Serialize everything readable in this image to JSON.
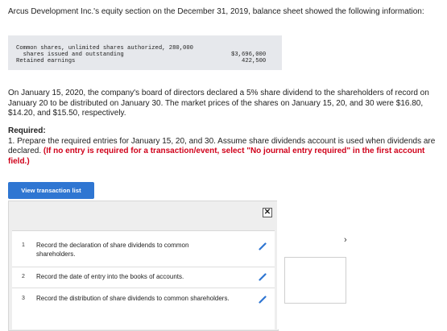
{
  "intro": "Arcus Development Inc.'s equity section on the December 31, 2019, balance sheet showed the following information:",
  "equity": {
    "line1": "Common shares, unlimited shares authorized, 280,000",
    "line2": "  shares issued and outstanding",
    "line2_value": "$3,696,000",
    "line3": "Retained earnings",
    "line3_value": "422,500"
  },
  "paragraph": "On January 15, 2020, the company's board of directors declared a 5% share dividend to the shareholders of record on January 20 to be distributed on January 30. The market prices of the shares on January 15, 20, and 30 were $16.80, $14.20, and $15.50, respectively.",
  "required": {
    "heading": "Required:",
    "text": "1. Prepare the required entries for January 15, 20, and 30. Assume share dividends account is used when dividends are declared.",
    "red_text": "(If no entry is required for a transaction/event, select \"No journal entry required\" in the first account field.)"
  },
  "button": {
    "label": "View transaction list"
  },
  "modal": {
    "close_glyph": "✕",
    "chevron_glyph": "›",
    "items": [
      {
        "num": "1",
        "text": "Record the declaration of share dividends to common shareholders."
      },
      {
        "num": "2",
        "text": "Record the date of entry into the books of accounts."
      },
      {
        "num": "3",
        "text": "Record the distribution of share dividends to common shareholders."
      }
    ]
  },
  "colors": {
    "accent": "#2f76d2",
    "required_red": "#d0021b",
    "table_bg": "#e6e8ec"
  }
}
